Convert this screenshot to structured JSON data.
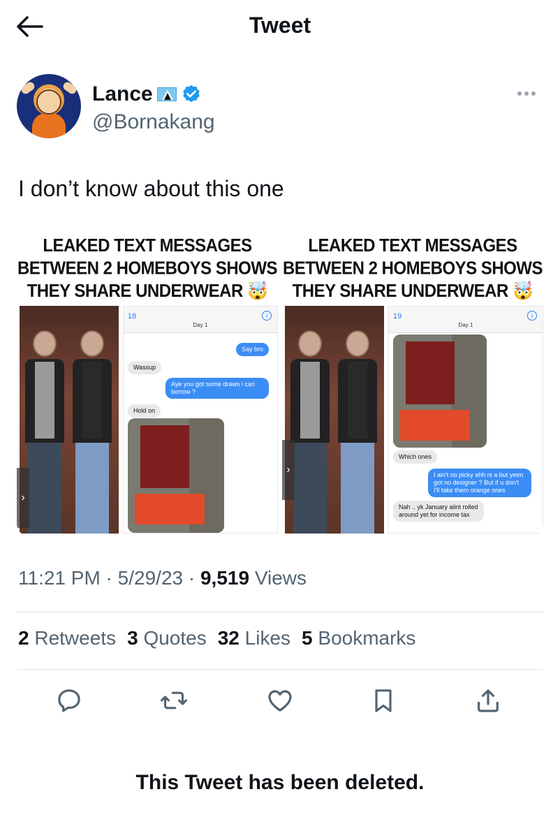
{
  "header": {
    "title": "Tweet"
  },
  "author": {
    "display_name": "Lance",
    "handle": "@Bornakang"
  },
  "tweet": {
    "text": "I don’t know about this one"
  },
  "media": {
    "left": {
      "headline_1": "LEAKED TEXT MESSAGES",
      "headline_2": "BETWEEN 2 HOMEBOYS SHOWS",
      "headline_3": "THEY SHARE UNDERWEAR",
      "emoji": "🤯",
      "back_count": "18",
      "contact": "Day 1",
      "msg_1": "Say bro",
      "msg_2": "Wassup",
      "msg_3": "Aye you got some draws i can borrow ?",
      "msg_4": "Hold on"
    },
    "right": {
      "headline_1": "LEAKED TEXT MESSAGES",
      "headline_2": "BETWEEN 2 HOMEBOYS SHOWS",
      "headline_3": "THEY SHARE UNDERWEAR",
      "emoji": "🤯",
      "back_count": "19",
      "contact": "Day 1",
      "msg_1": "Which ones",
      "msg_2": "I ain't no picky ahh ni a but yeen got no designer ? But if u don't I'll take them orange ones",
      "msg_3": "Nah .. yk January aiint rolled around yet for income tax"
    }
  },
  "meta": {
    "time": "11:21 PM",
    "date": "5/29/23",
    "views_count": "9,519",
    "views_label": "Views",
    "sep": "·"
  },
  "stats": {
    "retweets_count": "2",
    "retweets_label": "Retweets",
    "quotes_count": "3",
    "quotes_label": "Quotes",
    "likes_count": "32",
    "likes_label": "Likes",
    "bookmarks_count": "5",
    "bookmarks_label": "Bookmarks"
  },
  "footer": {
    "deleted_notice": "This Tweet has been deleted."
  },
  "colors": {
    "verified": "#1d9bf0",
    "muted": "#536471",
    "text": "#0f1419",
    "bubble_out": "#3b8df5"
  },
  "icons": [
    "back-arrow-icon",
    "verified-badge-icon",
    "more-icon",
    "reply-icon",
    "retweet-icon",
    "like-icon",
    "bookmark-icon",
    "share-icon"
  ]
}
